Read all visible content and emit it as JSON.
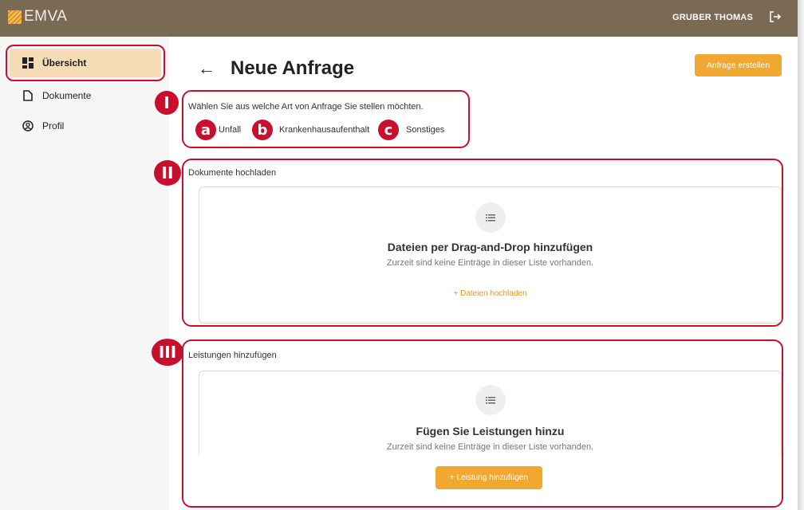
{
  "app": {
    "logo_text": "EMVA",
    "user_name": "GRUBER THOMAS"
  },
  "sidebar": {
    "items": [
      {
        "label": "Übersicht",
        "icon": "dashboard-icon",
        "active": true
      },
      {
        "label": "Dokumente",
        "icon": "document-icon",
        "active": false
      },
      {
        "label": "Profil",
        "icon": "profile-icon",
        "active": false
      }
    ]
  },
  "header": {
    "title": "Neue Anfrage",
    "create_button": "Anfrage erstellen"
  },
  "annotations": {
    "section_markers": [
      "I",
      "II",
      "III"
    ],
    "option_markers": [
      "a",
      "b",
      "c"
    ],
    "color": "#c8102e"
  },
  "request_type": {
    "prompt": "Wählen Sie aus welche Art von Anfrage Sie stellen möchten.",
    "options": [
      "Unfall",
      "Krankenhausaufenthalt",
      "Sonstiges"
    ]
  },
  "documents": {
    "section_title": "Dokumente hochladen",
    "empty_title": "Dateien per Drag-and-Drop hinzufügen",
    "empty_subtitle": "Zurzeit sind keine Einträge in dieser Liste vorhanden.",
    "upload_link": "+   Dateien hochladen"
  },
  "services": {
    "section_title": "Leistungen hinzufügen",
    "empty_title": "Fügen Sie Leistungen hinzu",
    "empty_subtitle": "Zurzeit sind keine Einträge in dieser Liste vorhanden.",
    "add_button": "+   Leistung hinzufügen"
  },
  "colors": {
    "topbar": "#7a6a55",
    "accent": "#f0a830",
    "active_bg": "#f5dbb6"
  }
}
